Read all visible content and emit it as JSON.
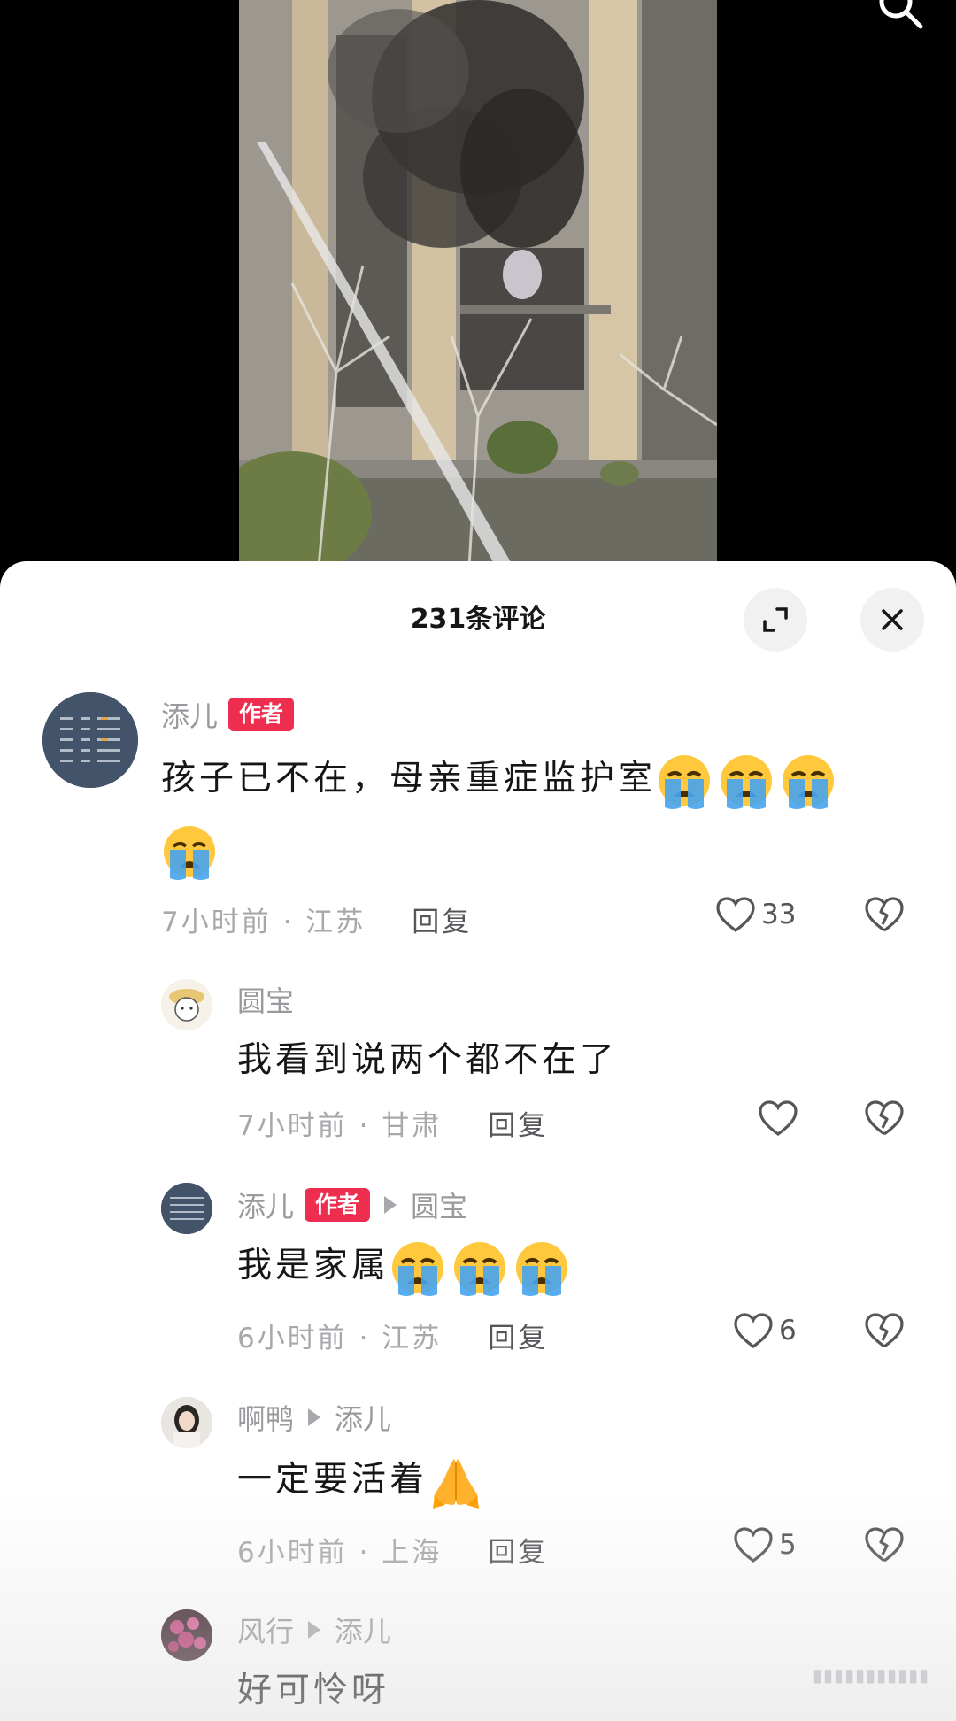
{
  "sheet": {
    "title": "231条评论"
  },
  "comments": [
    {
      "name": "添儿",
      "badge": "作者",
      "text": "孩子已不在，母亲重症监护室",
      "time_location": "7小时前 · 江苏",
      "reply_label": "回复",
      "likes": "33"
    },
    {
      "name": "圆宝",
      "text": "我看到说两个都不在了",
      "time_location": "7小时前 · 甘肃",
      "reply_label": "回复",
      "likes": ""
    },
    {
      "name": "添儿",
      "badge": "作者",
      "reply_to": "圆宝",
      "text": "我是家属",
      "time_location": "6小时前 · 江苏",
      "reply_label": "回复",
      "likes": "6"
    },
    {
      "name": "啊鸭",
      "reply_to": "添儿",
      "text": "一定要活着",
      "time_location": "6小时前 · 上海",
      "reply_label": "回复",
      "likes": "5"
    },
    {
      "name": "风行",
      "reply_to": "添儿",
      "text": "好可怜呀"
    }
  ],
  "icons": {
    "search": "search-icon",
    "expand": "expand-icon",
    "close": "close-icon",
    "like": "heart-icon",
    "dislike": "broken-heart-icon",
    "cry": "loudly-crying-face-emoji",
    "pray": "folded-hands-emoji"
  },
  "colors": {
    "badge": "#ee2e4f",
    "text": "#161616",
    "secondary": "#a8a8ac"
  }
}
